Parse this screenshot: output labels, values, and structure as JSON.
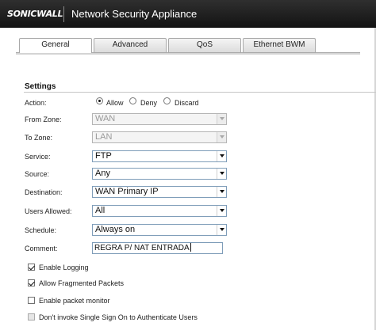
{
  "header": {
    "logo_text": "SONICWALL",
    "app_title": "Network Security Appliance",
    "background": "#1e1e1e"
  },
  "tabs": [
    {
      "label": "General",
      "active": true
    },
    {
      "label": "Advanced",
      "active": false
    },
    {
      "label": "QoS",
      "active": false
    },
    {
      "label": "Ethernet BWM",
      "active": false
    }
  ],
  "settings": {
    "section_title": "Settings",
    "action": {
      "label": "Action:",
      "options": [
        "Allow",
        "Deny",
        "Discard"
      ],
      "selected": "Allow"
    },
    "from_zone": {
      "label": "From Zone:",
      "value": "WAN",
      "disabled": true
    },
    "to_zone": {
      "label": "To Zone:",
      "value": "LAN",
      "disabled": true
    },
    "service": {
      "label": "Service:",
      "value": "FTP"
    },
    "source": {
      "label": "Source:",
      "value": "Any"
    },
    "destination": {
      "label": "Destination:",
      "value": "WAN Primary IP"
    },
    "users_allowed": {
      "label": "Users Allowed:",
      "value": "All"
    },
    "schedule": {
      "label": "Schedule:",
      "value": "Always on"
    },
    "comment": {
      "label": "Comment:",
      "value": "REGRA P/ NAT ENTRADA"
    }
  },
  "options": [
    {
      "label": "Enable Logging",
      "checked": true,
      "disabled": false
    },
    {
      "label": "Allow Fragmented Packets",
      "checked": true,
      "disabled": false
    },
    {
      "label": "Enable packet monitor",
      "checked": false,
      "disabled": false
    },
    {
      "label": "Don't invoke Single Sign On to Authenticate Users",
      "checked": false,
      "disabled": true
    }
  ]
}
